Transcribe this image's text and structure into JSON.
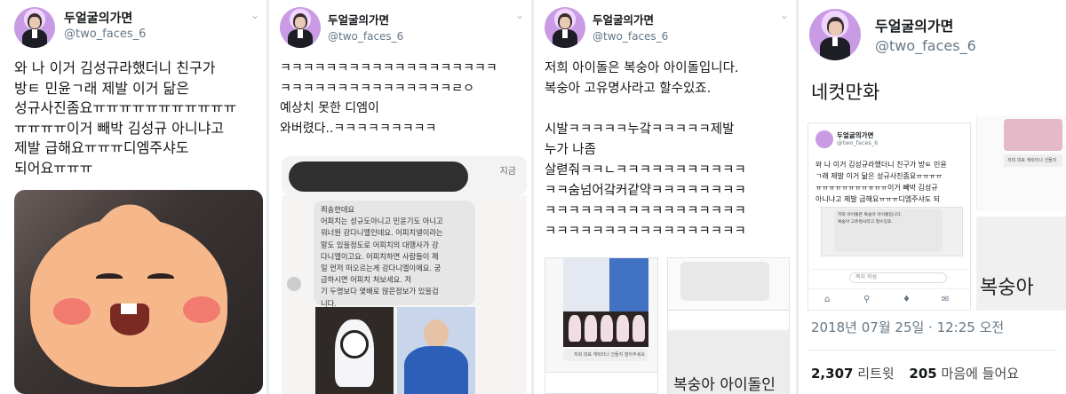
{
  "profile": {
    "name": "두얼굴의가면",
    "handle": "@two_faces_6"
  },
  "panel1": {
    "text": "와 나 이거 김성규라했더니 친구가\n방ㅌ 민윤ㄱ래 제발 이거 닮은\n성규사진좀요ㅠㅠㅠㅠㅠㅠㅠㅠㅠㅠㅠ\nㅠㅠㅠㅠ이거 빼박 김성규 아니냐고\n제발 급해요ㅠㅠㅠ디엠주샤도\n되어요ㅠㅠㅠ"
  },
  "panel2": {
    "text": "ㅋㅋㅋㅋㅋㅋㅋㅋㅋㅋㅋㅋㅋㅋㅋㅋㅋㅋㅋ\nㅋㅋㅋㅋㅋㅋㅋㅋㅋㅋㅋㅋㅋㅋㅋㄹㅇ\n예상치 못한 디엠이\n와버렸다..ㅋㅋㅋㅋㅋㅋㅋㅋㅋ",
    "notification_time": "지금",
    "dm_text": "죄송한데요\n어피치는 성규도아니고 민윤기도 아니고\n워너원 강다니엘인데요. 어피치넬이라는\n말도 있을정도로 어피치의 대행사가 강\n다니엘이고요. 어피치하면 사람들이 제\n일 먼저 떠오르는게 강다니엘이에요. 궁\n금하시면 어피치 처보세요. 저\n기 두명보다 몇배로 많은정보가 있을겁\n니다."
  },
  "panel3": {
    "text": "저희 아이돌은 복숭아 아이돌입니다.\n복숭아 고유명사라고 할수있죠.\n\n시발ㅋㅋㅋㅋㅋ누갘ㅋㅋㅋㅋㅋ제발\n누가 나좀\n살렫줘ㅋㅋㄴㅋㅋㅋㅋㅋㅋㅋㅋㅋㅋㅋ\nㅋㅋ숨넘어갘커같약ㅋㅋㅋㅋㅋㅋㅋㅋ\nㅋㅋㅋㅋㅋㅋㅋㅋㅋㅋㅋㅋㅋㅋㅋㅋㅋ\nㅋㅋㅋㅋㅋㅋㅋㅋㅋㅋㅋㅋㅋㅋㅋㅋㅋ",
    "caption": "저희 대표 캐릭터나 건들지 말아주세요",
    "big_text": "복숭아 아이돌인"
  },
  "panel4": {
    "text": "네컷만화",
    "mini_tweet": "와 나 이거 김성규라했더니 친구가 방ㅌ 민윤\nㄱ래 제발 이거 닮은 성규사진좀요ㅠㅠㅠㅠ\nㅠㅠㅠㅠㅠㅠㅠㅠㅠㅠㅠ이거 빼박 김성규\n아니냐고 제발 급해요ㅠㅠㅠ디엠주샤도 되",
    "mini_dm": "저희 아이돌은 복숭아 아이돌입니다.\n복숭아 고유명사라고 할수있죠.",
    "compose_placeholder": "쪽지 작성",
    "side_caption": "저희 대표 캐릭터나 건들지",
    "side_big_text": "복숭아",
    "date": "2018년 07월 25일 · 12:25 오전",
    "retweets_count": "2,307",
    "retweets_label": "리트윗",
    "likes_count": "205",
    "likes_label": "마음에 들어요"
  }
}
